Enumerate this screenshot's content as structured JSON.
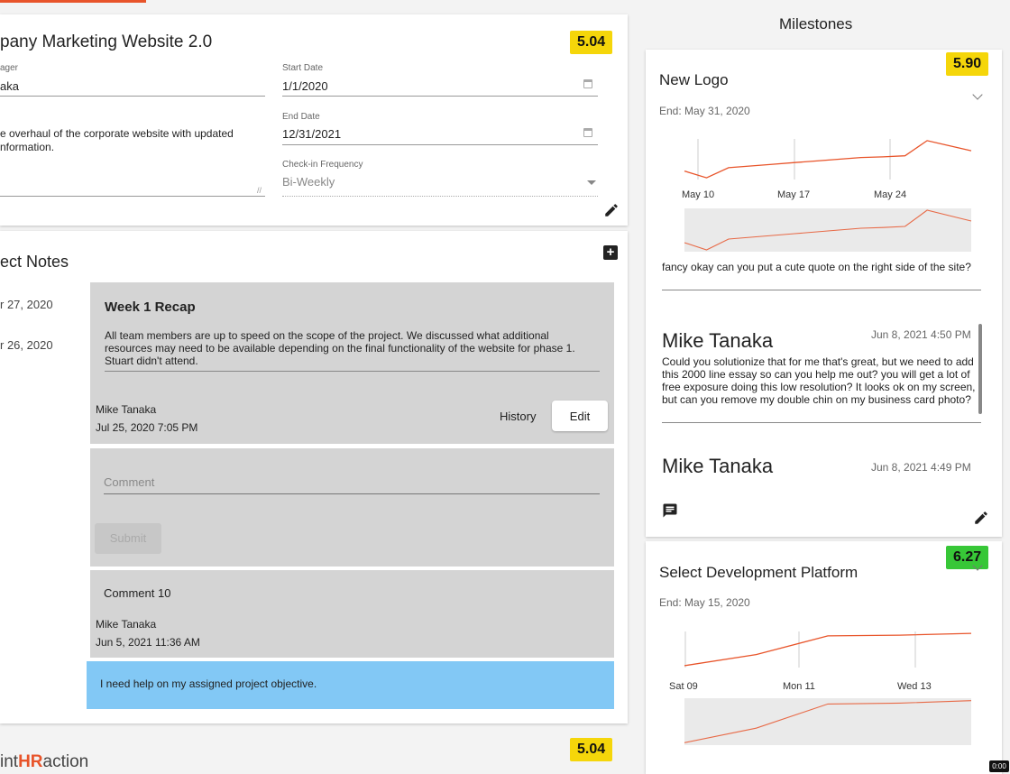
{
  "project": {
    "title": "pany Marketing Website 2.0",
    "score": "5.04",
    "manager_label": "ager",
    "manager_value": "aka",
    "start_label": "Start Date",
    "start_value": "1/1/2020",
    "end_label": "End Date",
    "end_value": "12/31/2021",
    "description_line1": "e overhaul of the corporate website with updated",
    "description_line2": "nformation.",
    "frequency_label": "Check-in Frequency",
    "frequency_value": "Bi-Weekly"
  },
  "notes": {
    "title": "ect Notes",
    "dates": [
      "r 27, 2020",
      "r 26, 2020"
    ],
    "note": {
      "title": "Week 1 Recap",
      "body": "All team members are up to speed on the scope of the project.  We discussed what additional resources may need to be available depending on the final functionality of the website for phase 1. Stuart didn't attend.",
      "author": "Mike Tanaka",
      "timestamp": "Jul 25, 2020 7:05 PM",
      "history_label": "History",
      "edit_label": "Edit"
    },
    "comment_placeholder": "Comment",
    "submit_label": "Submit",
    "comment": {
      "text": "Comment 10",
      "author": "Mike Tanaka",
      "timestamp": "Jun 5, 2021 11:36 AM"
    },
    "help_text": "I need help on my assigned project objective."
  },
  "footer": {
    "logo_prefix": "int",
    "logo_hr": "HR",
    "logo_suffix": "action",
    "score": "5.04"
  },
  "milestones": {
    "title": "Milestones",
    "items": [
      {
        "title": "New Logo",
        "end": "End: May 31, 2020",
        "score": "5.90",
        "chat_top": "fancy okay can you put a cute quote on the right side of the site?",
        "messages": [
          {
            "author": "Mike Tanaka",
            "time": "Jun 8, 2021 4:50 PM",
            "text": "Could you solutionize that for me that's great, but we need to add this 2000 line essay so can you help me out? you will get a lot of free exposure doing this low resolution? It looks ok on my screen, but can you remove my double chin on my business card photo?"
          },
          {
            "author": "Mike Tanaka",
            "time": "Jun 8, 2021 4:49 PM"
          }
        ]
      },
      {
        "title": "Select Development Platform",
        "end": "End: May 15, 2020",
        "score": "6.27"
      }
    ]
  },
  "chart_data": [
    {
      "type": "line",
      "x_ticks": [
        "May 10",
        "May 17",
        "May 24"
      ],
      "series": [
        {
          "values": [
            5.2,
            5.0,
            5.3,
            5.35,
            5.4,
            5.45,
            5.5,
            5.55,
            5.6,
            5.62,
            5.65,
            6.1,
            5.95,
            5.8
          ]
        }
      ]
    },
    {
      "type": "line",
      "x_ticks": [
        "Sat 09",
        "Mon 11",
        "Wed 13"
      ],
      "series": [
        {
          "values": [
            5.4,
            5.7,
            6.2,
            6.22,
            6.27
          ]
        }
      ]
    }
  ],
  "colors": {
    "accent": "#e8542a",
    "yellow": "#f5d60a",
    "green": "#37c737",
    "help": "#82c8f5"
  }
}
